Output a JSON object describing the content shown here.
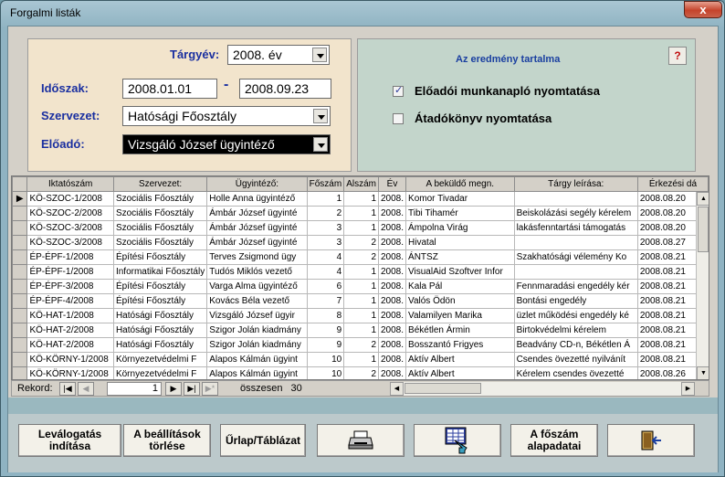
{
  "window": {
    "title": "Forgalmi listák",
    "close": "x"
  },
  "filters": {
    "targyev_label": "Tárgyév:",
    "targyev_value": "2008. év",
    "idoszak_label": "Időszak:",
    "idoszak_from": "2008.01.01",
    "idoszak_sep": "-",
    "idoszak_to": "2008.09.23",
    "szervezet_label": "Szervezet:",
    "szervezet_value": "Hatósági Főosztály",
    "eloado_label": "Előadó:",
    "eloado_value": "Vizsgáló József ügyintéző"
  },
  "result": {
    "title": "Az eredmény tartalma",
    "help": "?",
    "opt1_label": "Előadói munkanapló nyomtatása",
    "opt1_checked": true,
    "opt2_label": "Átadókönyv nyomtatása",
    "opt2_checked": false
  },
  "grid": {
    "columns": [
      "Iktatószám",
      "Szervezet:",
      "Ügyintéző:",
      "Főszám",
      "Alszám",
      "Év",
      "A beküldő megn.",
      "Tárgy leírása:",
      "Érkezési dá"
    ],
    "current_row_marker": "▶",
    "rows": [
      [
        "KÖ-SZOC-1/2008",
        "Szociális Főosztály",
        "Holle Anna ügyintéző",
        "1",
        "1",
        "2008.",
        "Komor Tivadar",
        "",
        "2008.08.20"
      ],
      [
        "KÖ-SZOC-2/2008",
        "Szociális Főosztály",
        "Ámbár József ügyinté",
        "2",
        "1",
        "2008.",
        "Tibi Tihamér",
        "Beiskolázási segély kérelem",
        "2008.08.20"
      ],
      [
        "KÖ-SZOC-3/2008",
        "Szociális Főosztály",
        "Ámbár József ügyinté",
        "3",
        "1",
        "2008.",
        "Ámpolna Virág",
        "lakásfenntartási támogatás",
        "2008.08.20"
      ],
      [
        "KÖ-SZOC-3/2008",
        "Szociális Főosztály",
        "Ámbár József ügyinté",
        "3",
        "2",
        "2008.",
        "Hivatal",
        "",
        "2008.08.27"
      ],
      [
        "ÉP-ÉPF-1/2008",
        "Építési Főosztály",
        "Terves Zsigmond ügy",
        "4",
        "2",
        "2008.",
        "ÁNTSZ",
        "Szakhatósági vélemény Ko",
        "2008.08.21"
      ],
      [
        "ÉP-ÉPF-1/2008",
        "Informatikai Főosztály",
        "Tudós Miklós vezető",
        "4",
        "1",
        "2008.",
        "VisualAid Szoftver Infor",
        "",
        "2008.08.21"
      ],
      [
        "ÉP-ÉPF-3/2008",
        "Építési Főosztály",
        "Varga Alma ügyintéző",
        "6",
        "1",
        "2008.",
        "Kala Pál",
        "Fennmaradási engedély kér",
        "2008.08.21"
      ],
      [
        "ÉP-ÉPF-4/2008",
        "Építési Főosztály",
        "Kovács Béla vezető",
        "7",
        "1",
        "2008.",
        "Valós Ödön",
        "Bontási engedély",
        "2008.08.21"
      ],
      [
        "KÖ-HAT-1/2008",
        "Hatósági Főosztály",
        "Vizsgáló József ügyir",
        "8",
        "1",
        "2008.",
        "Valamilyen Marika",
        "üzlet működési engedély ké",
        "2008.08.21"
      ],
      [
        "KÖ-HAT-2/2008",
        "Hatósági Főosztály",
        "Szigor Jolán kiadmány",
        "9",
        "1",
        "2008.",
        "Békétlen Ármin",
        "Birtokvédelmi kérelem",
        "2008.08.21"
      ],
      [
        "KÖ-HAT-2/2008",
        "Hatósági Főosztály",
        "Szigor Jolán kiadmány",
        "9",
        "2",
        "2008.",
        "Bosszantó Frigyes",
        "Beadvány CD-n, Békétlen Á",
        "2008.08.21"
      ],
      [
        "KÖ-KÖRNY-1/2008",
        "Környezetvédelmi F",
        "Alapos Kálmán ügyint",
        "10",
        "1",
        "2008.",
        "Aktív Albert",
        "Csendes övezetté nyilvánít",
        "2008.08.21"
      ],
      [
        "KÖ-KÖRNY-1/2008",
        "Környezetvédelmi F",
        "Alapos Kálmán ügyint",
        "10",
        "2",
        "2008.",
        "Aktív Albert",
        "Kérelem csendes övezetté",
        "2008.08.26"
      ]
    ]
  },
  "nav": {
    "label": "Rekord:",
    "current": "1",
    "total_label": "összesen",
    "total": "30"
  },
  "footer": {
    "btn1_line1": "Leválogatás",
    "btn1_line2": "indítása",
    "btn2_line1": "A beállítások",
    "btn2_line2": "törlése",
    "btn3": "Űrlap/Táblázat",
    "btn4_icon": "printer-icon",
    "btn5_icon": "export-icon",
    "btn6_line1": "A főszám",
    "btn6_line2": "alapadatai",
    "btn7_icon": "exit-door-icon"
  }
}
